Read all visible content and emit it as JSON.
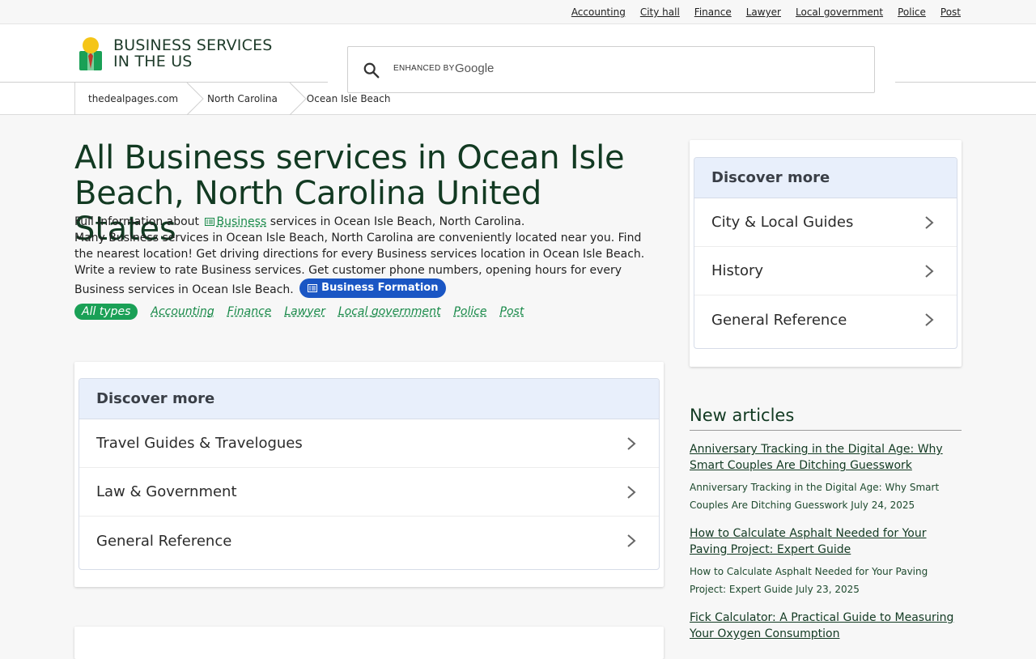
{
  "topnav": [
    "Accounting",
    "City hall",
    "Finance",
    "Lawyer",
    "Local government",
    "Police",
    "Post"
  ],
  "brand": {
    "line1": "BUSINESS SERVICES",
    "line2": "IN THE US",
    "logo_icon": "person-pin-icon"
  },
  "search": {
    "enhanced_label": "ENHANCED BY",
    "google_label": "Google",
    "icon": "search-icon"
  },
  "breadcrumb": [
    "thedealpages.com",
    "North Carolina",
    "Ocean Isle Beach"
  ],
  "main": {
    "title": "All Business services in Ocean Isle Beach, North Carolina United States",
    "intro_prefix": "Full information about",
    "intro_link": "Business",
    "intro_suffix": "services in Ocean Isle Beach, North Carolina.",
    "intro_body": "Many Business services in Ocean Isle Beach, North Carolina are conveniently located near you. Find the nearest location! Get driving directions for every Business services location in Ocean Isle Beach. Write a review to rate Business services. Get customer phone numbers, opening hours for every Business services in Ocean Isle Beach.",
    "pill_label": "Business Formation",
    "types_active": "All types",
    "types": [
      "Accounting",
      "Finance",
      "Lawyer",
      "Local government",
      "Police",
      "Post"
    ]
  },
  "discover_main": {
    "heading": "Discover more",
    "items": [
      "Travel Guides & Travelogues",
      "Law & Government",
      "General Reference"
    ]
  },
  "discover_side": {
    "heading": "Discover more",
    "items": [
      "City & Local Guides",
      "History",
      "General Reference"
    ]
  },
  "new_articles": {
    "heading": "New articles",
    "items": [
      {
        "title": "Anniversary Tracking in the Digital Age: Why Smart Couples Are Ditching Guesswork",
        "desc": "Anniversary Tracking in the Digital Age: Why Smart Couples Are Ditching Guesswork July 24, 2025"
      },
      {
        "title": "How to Calculate Asphalt Needed for Your Paving Project: Expert Guide",
        "desc": "How to Calculate Asphalt Needed for Your Paving Project: Expert Guide July 23, 2025"
      },
      {
        "title": "Fick Calculator: A Practical Guide to Measuring Your Oxygen Consumption",
        "desc": ""
      }
    ]
  },
  "colors": {
    "accent_green": "#1aa056",
    "link_green": "#1a8a4a",
    "pill_blue": "#1a56c4",
    "discover_head_bg": "#e8effb",
    "title_green": "#123a22"
  }
}
